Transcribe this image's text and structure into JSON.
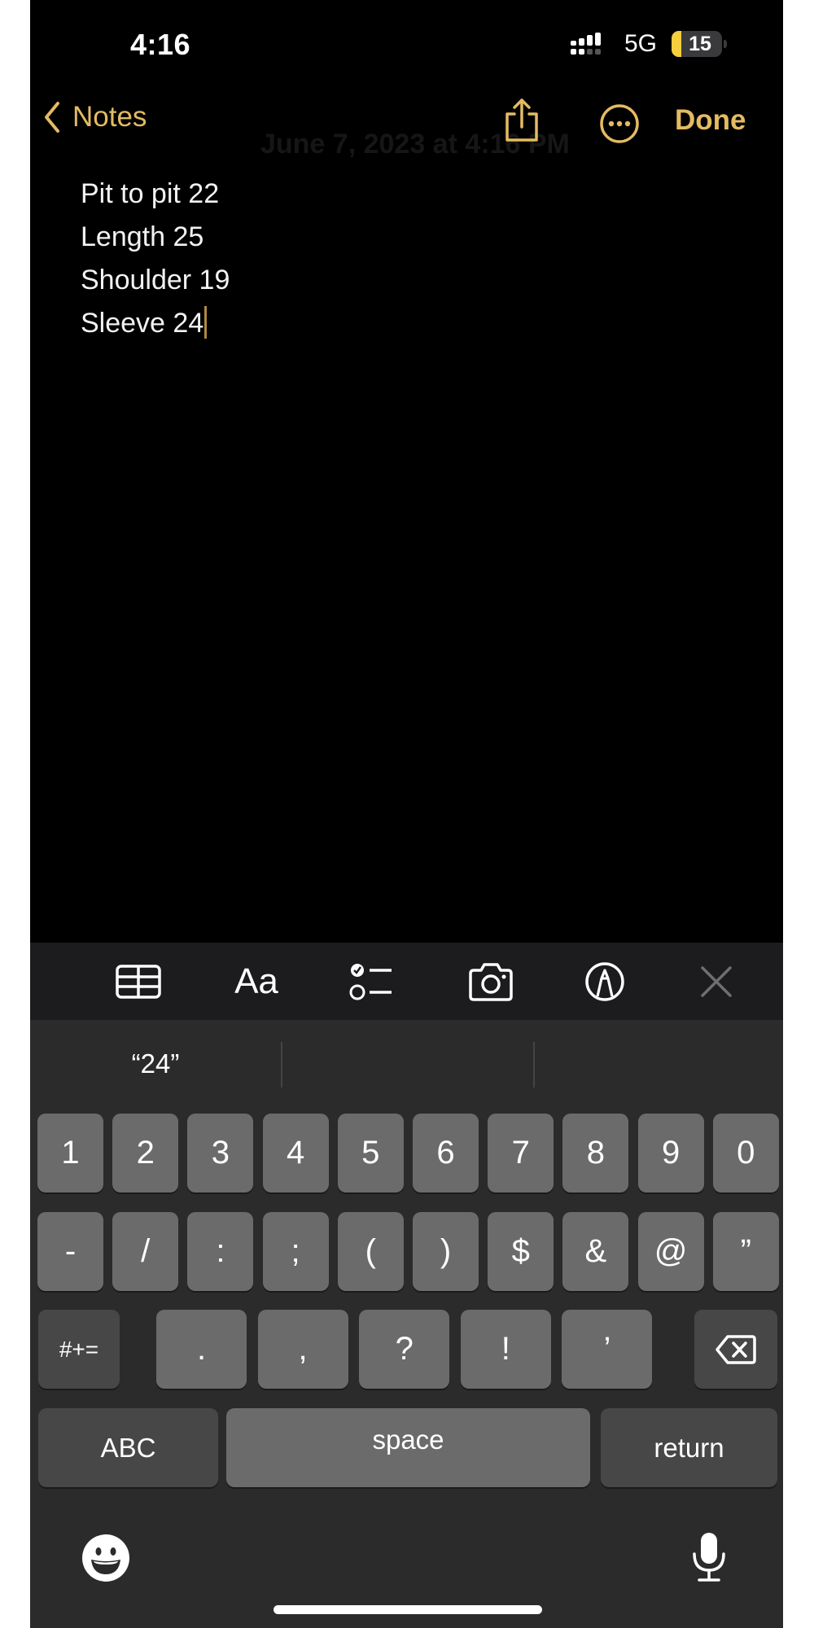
{
  "status_bar": {
    "time": "4:16",
    "network": "5G",
    "battery_percent": "15",
    "battery_level": 0.15,
    "low_power_mode": true,
    "signal_icon": "dual-signal-bars-icon"
  },
  "nav": {
    "back_label": "Notes",
    "faint_date": "June 7, 2023 at 4:16 PM",
    "share_icon": "share-icon",
    "more_icon": "ellipsis-circle-icon",
    "done_label": "Done"
  },
  "note": {
    "lines": [
      "Pit to pit 22",
      "Length 25",
      "Shoulder 19",
      "Sleeve 24"
    ]
  },
  "toolbar": {
    "items": [
      {
        "name": "table-icon"
      },
      {
        "name": "format-text-icon",
        "label": "Aa"
      },
      {
        "name": "checklist-icon"
      },
      {
        "name": "camera-icon"
      },
      {
        "name": "markup-icon"
      },
      {
        "name": "close-icon"
      }
    ]
  },
  "keyboard": {
    "suggestions": [
      "“24”",
      "",
      ""
    ],
    "row1": [
      "1",
      "2",
      "3",
      "4",
      "5",
      "6",
      "7",
      "8",
      "9",
      "0"
    ],
    "row2": [
      "-",
      "/",
      ":",
      ";",
      "(",
      ")",
      "$",
      "&",
      "@",
      "”"
    ],
    "row3": {
      "shift_label": "#+=",
      "keys": [
        ".",
        ",",
        "?",
        "!",
        "’"
      ],
      "delete_icon": "delete-backspace-icon"
    },
    "row4": {
      "abc_label": "ABC",
      "space_label": "space",
      "return_label": "return"
    },
    "emoji_icon": "emoji-icon",
    "mic_icon": "microphone-icon"
  },
  "colors": {
    "accent": "#e3bb62",
    "background": "#000000",
    "toolbar": "#1c1c1e",
    "keyboard": "#2b2b2b",
    "key": "#6b6b6b",
    "special_key": "#474747",
    "low_power_battery": "#f5cf3d"
  }
}
